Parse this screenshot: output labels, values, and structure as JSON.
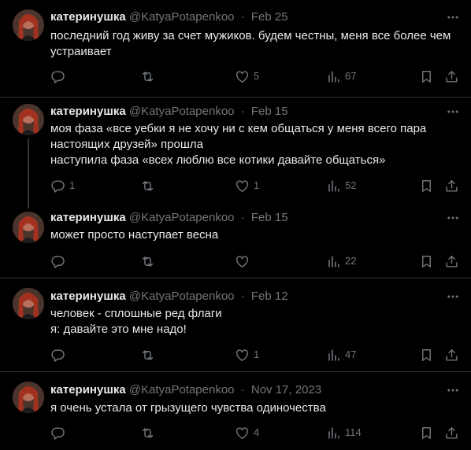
{
  "colors": {
    "background": "#000000",
    "text": "#e7e9ea",
    "secondary": "#71767b",
    "divider": "#2f3336"
  },
  "icons": {
    "reply": "reply-icon",
    "retweet": "retweet-icon",
    "like": "heart-icon",
    "views": "views-icon",
    "bookmark": "bookmark-icon",
    "share": "share-icon",
    "more": "more-icon"
  },
  "tweets": [
    {
      "name": "катеринушка",
      "handle": "@KatyaPotapenkoo",
      "separator": "·",
      "date": "Feb 25",
      "lines": [
        "последний год живу за счет мужиков. будем честны, меня все более чем",
        "устраивает"
      ],
      "replies": "",
      "retweets": "",
      "likes": "5",
      "views": "67"
    },
    {
      "name": "катеринушка",
      "handle": "@KatyaPotapenkoo",
      "separator": "·",
      "date": "Feb 15",
      "lines": [
        "моя фаза «все уебки я не хочу ни с кем общаться у меня всего пара",
        "настоящих друзей» прошла",
        "наступила  фаза «всех люблю все котики давайте общаться»"
      ],
      "replies": "1",
      "retweets": "",
      "likes": "1",
      "views": "52"
    },
    {
      "name": "катеринушка",
      "handle": "@KatyaPotapenkoo",
      "separator": "·",
      "date": "Feb 15",
      "lines": [
        "может просто наступает весна"
      ],
      "replies": "",
      "retweets": "",
      "likes": "",
      "views": "22"
    },
    {
      "name": "катеринушка",
      "handle": "@KatyaPotapenkoo",
      "separator": "·",
      "date": "Feb 12",
      "lines": [
        "человек - сплошные ред флаги",
        "я: давайте это мне надо!"
      ],
      "replies": "",
      "retweets": "",
      "likes": "1",
      "views": "47"
    },
    {
      "name": "катеринушка",
      "handle": "@KatyaPotapenkoo",
      "separator": "·",
      "date": "Nov 17, 2023",
      "lines": [
        "я очень устала от грызущего чувства одиночества"
      ],
      "replies": "",
      "retweets": "",
      "likes": "4",
      "views": "114"
    }
  ]
}
